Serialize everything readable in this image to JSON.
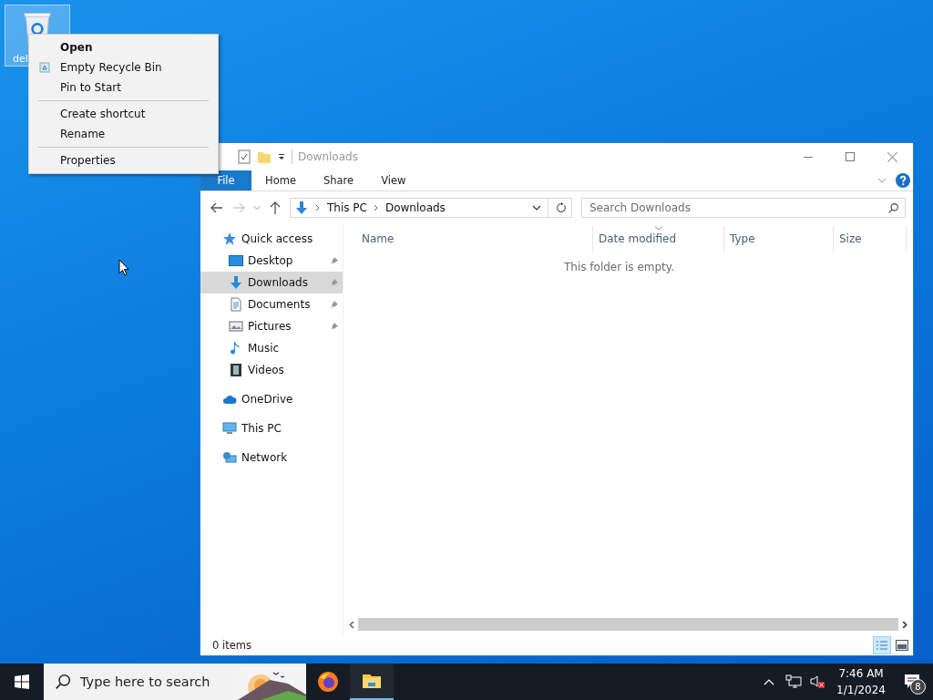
{
  "desktop": {
    "icon": {
      "label": "del",
      "selected": true
    }
  },
  "context_menu": {
    "groups": [
      [
        {
          "label": "Open",
          "default": true,
          "kind": "plain"
        },
        {
          "label": "Empty Recycle Bin",
          "default": false,
          "kind": "recycle"
        },
        {
          "label": "Pin to Start",
          "default": false,
          "kind": "plain"
        }
      ],
      [
        {
          "label": "Create shortcut",
          "default": false,
          "kind": "plain"
        },
        {
          "label": "Rename",
          "default": false,
          "kind": "plain"
        }
      ],
      [
        {
          "label": "Properties",
          "default": false,
          "kind": "plain"
        }
      ]
    ]
  },
  "explorer": {
    "title": "Downloads",
    "ribbon_tabs": [
      {
        "label": "File",
        "kind": "file"
      },
      {
        "label": "Home",
        "kind": "tab"
      },
      {
        "label": "Share",
        "kind": "tab"
      },
      {
        "label": "View",
        "kind": "tab"
      }
    ],
    "address": {
      "path": [
        "This PC",
        "Downloads"
      ]
    },
    "search": {
      "placeholder": "Search Downloads"
    },
    "nav": [
      {
        "label": "Quick access",
        "kind": "star",
        "selected": false,
        "children": [
          {
            "label": "Desktop",
            "kind": "desktop",
            "pinned": true,
            "selected": false
          },
          {
            "label": "Downloads",
            "kind": "download",
            "pinned": true,
            "selected": true
          },
          {
            "label": "Documents",
            "kind": "document",
            "pinned": true,
            "selected": false
          },
          {
            "label": "Pictures",
            "kind": "pictures",
            "pinned": true,
            "selected": false
          },
          {
            "label": "Music",
            "kind": "music",
            "pinned": false,
            "selected": false
          },
          {
            "label": "Videos",
            "kind": "videos",
            "pinned": false,
            "selected": false
          }
        ]
      },
      {
        "label": "OneDrive",
        "kind": "cloud",
        "selected": false
      },
      {
        "label": "This PC",
        "kind": "pc",
        "selected": false
      },
      {
        "label": "Network",
        "kind": "network",
        "selected": false
      }
    ],
    "columns": [
      {
        "label": "Name",
        "sorted": false
      },
      {
        "label": "Date modified",
        "sorted": true
      },
      {
        "label": "Type",
        "sorted": false
      },
      {
        "label": "Size",
        "sorted": false
      }
    ],
    "empty_message": "This folder is empty.",
    "status": "0 items",
    "views": [
      {
        "kind": "details",
        "selected": true
      },
      {
        "kind": "large",
        "selected": false
      }
    ]
  },
  "taskbar": {
    "search": {
      "placeholder": "Type here to search"
    },
    "apps": [
      {
        "kind": "firefox",
        "active": false
      },
      {
        "kind": "explorer",
        "active": true
      }
    ],
    "time": "7:46 AM",
    "date": "1/1/2024",
    "notifications": "8"
  }
}
